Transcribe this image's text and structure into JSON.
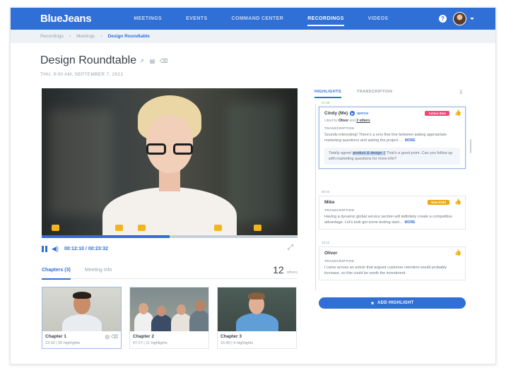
{
  "app": {
    "logo": "BlueJeans"
  },
  "nav": {
    "items": [
      {
        "label": "MEETINGS",
        "active": false
      },
      {
        "label": "EVENTS",
        "active": false
      },
      {
        "label": "COMMAND CENTER",
        "active": false
      },
      {
        "label": "RECORDINGS",
        "active": true
      },
      {
        "label": "VIDEOS",
        "active": false
      }
    ],
    "help_glyph": "?"
  },
  "breadcrumb": {
    "items": [
      "Recordings",
      "Meetings",
      "Design Roundtable"
    ],
    "separator": "›"
  },
  "recording": {
    "title": "Design Roundtable",
    "date": "THU, 9:00 AM, SEPTEMBER 7, 2021"
  },
  "player": {
    "time": "00:12:10 / 00:23:32",
    "progress": 0.5
  },
  "lower_tabs": {
    "items": [
      "Chapters (3)",
      "Meeting Info"
    ],
    "others_count": "12",
    "others_label": "others"
  },
  "chapters": [
    {
      "title": "Chapter 1",
      "meta": "23:32 | 56 highlights"
    },
    {
      "title": "Chapter 2",
      "meta": "07:27 | 11 highlights"
    },
    {
      "title": "Chapter 3",
      "meta": "15:40 | 4 highlights"
    }
  ],
  "panel": {
    "tabs": [
      "HIGHLIGHTS",
      "TRANSCRIPTION"
    ],
    "timestamps": [
      "07:38",
      "08:40",
      "10:12"
    ],
    "highlights": [
      {
        "name": "Cindy (Me)",
        "watch": "WATCH",
        "badge": "Action Item",
        "badge_color": "#ec4a76",
        "liked_prefix": "Liked by",
        "liked_by": "Oliver",
        "liked_and": "and",
        "liked_others": "2 others",
        "transcription_label": "TRANSCRIPTION",
        "text": "Sounds interesting! There's a very fine line between asking appropriate marketing questions and asking the project ...",
        "more": "MORE",
        "reply_before": "Totally agree! ",
        "reply_highlight": "product & design :)",
        "reply_after": " That's a good point. Can you follow up with marketing questions for more info?"
      },
      {
        "name": "Mike",
        "badge": "New Field",
        "badge_color": "#f3a51c",
        "transcription_label": "TRANSCRIPTION",
        "text": "Having a dynamic global service section will definitely create a competitive advantage. Let's look get some testing start...",
        "more": "MORE"
      },
      {
        "name": "Oliver",
        "transcription_label": "TRANSCRIPTION",
        "text": "I came across an article that argued customer retention would probably increase, so this could be worth the investment."
      }
    ],
    "add_button": "ADD HIGHLIGHT"
  },
  "colors": {
    "brand": "#2f6fd6",
    "marker": "#f3b51c"
  }
}
